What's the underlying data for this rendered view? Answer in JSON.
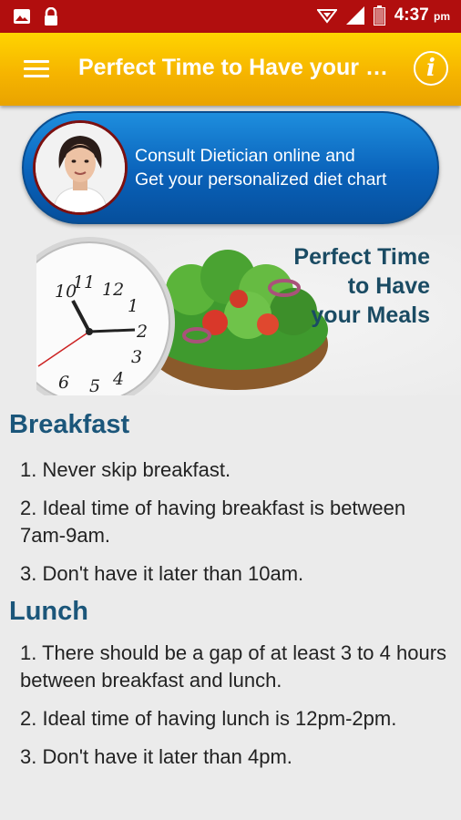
{
  "status_bar": {
    "time": "4:37",
    "ampm": "pm",
    "icons": [
      "image-icon",
      "lock-icon",
      "signal-icon",
      "battery-icon"
    ]
  },
  "app_bar": {
    "title": "Perfect Time to Have your Meals",
    "menu_icon": "hamburger-icon",
    "info_icon": "info-icon",
    "info_glyph": "i"
  },
  "banner": {
    "line1": "Consult Dietician online and",
    "line2": "Get your personalized diet chart"
  },
  "hero": {
    "line1": "Perfect Time",
    "line2": "to Have",
    "line3": "your Meals"
  },
  "sections": [
    {
      "heading": "Breakfast",
      "items": [
        "1. Never skip breakfast.",
        "2. Ideal time of having breakfast is between 7am-9am.",
        "3. Don't have it later than 10am."
      ]
    },
    {
      "heading": "Lunch",
      "items": [
        "1. There should be a gap of at least 3 to 4 hours between breakfast and lunch.",
        "2. Ideal time of having lunch is 12pm-2pm.",
        "3. Don't have it later than 4pm."
      ]
    }
  ],
  "colors": {
    "status_bar": "#b10e0e",
    "app_bar": "#f6b500",
    "banner": "#0a62ba",
    "heading": "#1b567a"
  }
}
